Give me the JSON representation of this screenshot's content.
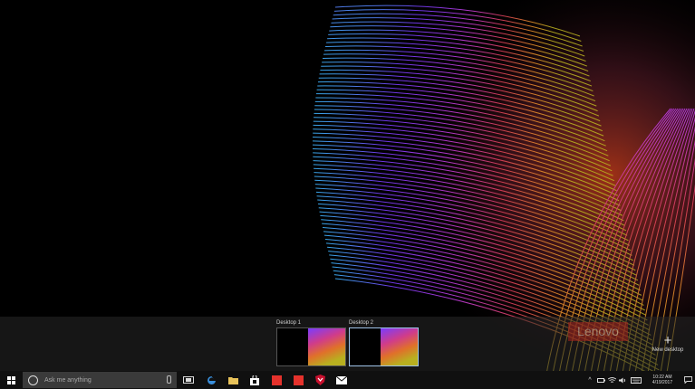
{
  "desktops": [
    {
      "label": "Desktop 1",
      "selected": false
    },
    {
      "label": "Desktop 2",
      "selected": true
    }
  ],
  "brand_watermark": "Lenovo",
  "new_desktop": {
    "icon": "plus-icon",
    "label": "New desktop"
  },
  "taskbar": {
    "search_placeholder": "Ask me anything",
    "apps": [
      {
        "name": "edge-icon",
        "color": "#3a8fdc"
      },
      {
        "name": "file-explorer-icon",
        "color": "#e8c25a"
      },
      {
        "name": "store-icon",
        "color": "#ffffff"
      },
      {
        "name": "red-app-icon",
        "color": "#e5322c"
      },
      {
        "name": "red-app-icon",
        "color": "#e5322c"
      },
      {
        "name": "mcafee-icon",
        "color": "#c8102e"
      },
      {
        "name": "mail-icon",
        "color": "#ffffff"
      }
    ],
    "clock": {
      "time": "10:22 AM",
      "date": "4/19/2017"
    }
  }
}
